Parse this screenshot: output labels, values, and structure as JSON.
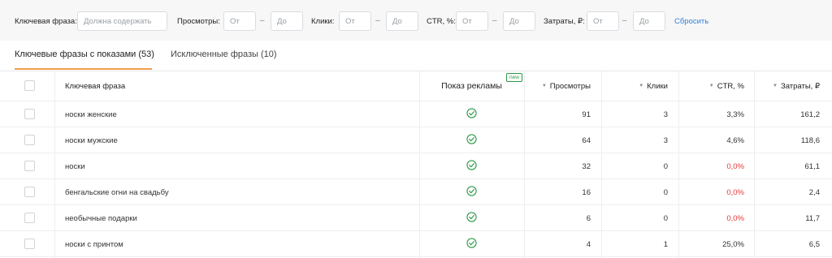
{
  "filters": {
    "phrase_label": "Ключевая фраза:",
    "phrase_placeholder": "Должна содержать",
    "views_label": "Просмотры:",
    "clicks_label": "Клики:",
    "ctr_label": "CTR, %:",
    "cost_label": "Затраты, ₽:",
    "from_placeholder": "От",
    "to_placeholder": "До",
    "dash": "–",
    "reset_label": "Сбросить"
  },
  "tabs": [
    {
      "label": "Ключевые фразы с показами (53)",
      "active": true
    },
    {
      "label": "Исключенные фразы (10)",
      "active": false
    }
  ],
  "table": {
    "headers": {
      "phrase": "Ключевая фраза",
      "ad_show": "Показ рекламы",
      "new_badge": "new",
      "views": "Просмотры",
      "clicks": "Клики",
      "ctr": "CTR, %",
      "cost": "Затраты, ₽"
    },
    "sort_icon": "triangle-down-icon",
    "status_icon": "check-circle-icon",
    "colors": {
      "accent": "#f39c4a",
      "link": "#2f7fd6",
      "ok": "#2e9a48",
      "bad": "#e53935"
    },
    "rows": [
      {
        "phrase": "носки женские",
        "views": "91",
        "clicks": "3",
        "ctr": "3,3%",
        "cost": "161,2",
        "ctr_zero": false
      },
      {
        "phrase": "носки мужские",
        "views": "64",
        "clicks": "3",
        "ctr": "4,6%",
        "cost": "118,6",
        "ctr_zero": false
      },
      {
        "phrase": "носки",
        "views": "32",
        "clicks": "0",
        "ctr": "0,0%",
        "cost": "61,1",
        "ctr_zero": true
      },
      {
        "phrase": "бенгальские огни на свадьбу",
        "views": "16",
        "clicks": "0",
        "ctr": "0,0%",
        "cost": "2,4",
        "ctr_zero": true
      },
      {
        "phrase": "необычные подарки",
        "views": "6",
        "clicks": "0",
        "ctr": "0,0%",
        "cost": "11,7",
        "ctr_zero": true
      },
      {
        "phrase": "носки с принтом",
        "views": "4",
        "clicks": "1",
        "ctr": "25,0%",
        "cost": "6,5",
        "ctr_zero": false
      }
    ]
  }
}
